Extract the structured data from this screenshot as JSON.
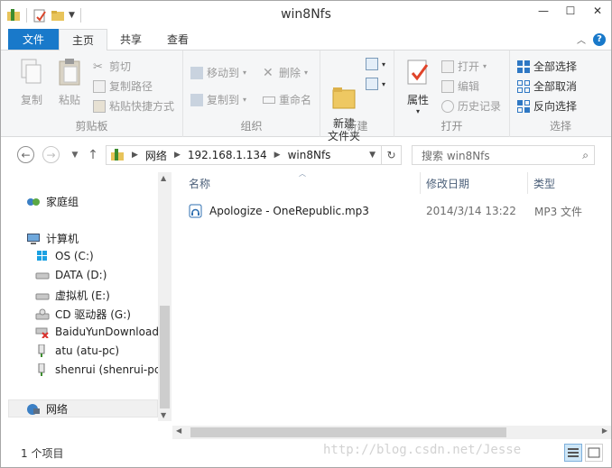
{
  "window": {
    "title": "win8Nfs"
  },
  "ribbon": {
    "tabs": [
      {
        "label": "文件"
      },
      {
        "label": "主页"
      },
      {
        "label": "共享"
      },
      {
        "label": "查看"
      }
    ],
    "clipboard": {
      "copy": "复制",
      "paste": "粘贴",
      "cut": "剪切",
      "copy_path": "复制路径",
      "paste_shortcut": "粘贴快捷方式",
      "label": "剪贴板"
    },
    "organize": {
      "move_to": "移动到",
      "copy_to": "复制到",
      "delete": "删除",
      "rename": "重命名",
      "label": "组织"
    },
    "new": {
      "new_folder": "新建\n文件夹",
      "label": "新建"
    },
    "open": {
      "properties": "属性",
      "open": "打开",
      "edit": "编辑",
      "history": "历史记录",
      "label": "打开"
    },
    "select": {
      "select_all": "全部选择",
      "select_none": "全部取消",
      "invert": "反向选择",
      "label": "选择"
    }
  },
  "address": {
    "crumbs": [
      "网络",
      "192.168.1.134",
      "win8Nfs"
    ],
    "search_placeholder": "搜索 win8Nfs"
  },
  "navpane": {
    "homegroup": "家庭组",
    "computer": "计算机",
    "drives": [
      "OS (C:)",
      "DATA (D:)",
      "虚拟机 (E:)",
      "CD 驱动器 (G:)",
      "BaiduYunDownload",
      "atu (atu-pc)",
      "shenrui (shenrui-pc)"
    ],
    "network": "网络"
  },
  "filelist": {
    "columns": {
      "name": "名称",
      "date": "修改日期",
      "type": "类型"
    },
    "rows": [
      {
        "name": "Apologize - OneRepublic.mp3",
        "date": "2014/3/14 13:22",
        "type": "MP3 文件"
      }
    ]
  },
  "status": {
    "count": "1 个项目",
    "watermark": "http://blog.csdn.net/Jesse"
  },
  "colors": {
    "accent": "#1979ca",
    "ribbon_bg": "#f5f6f7",
    "disabled_text": "#9b9b9b"
  }
}
